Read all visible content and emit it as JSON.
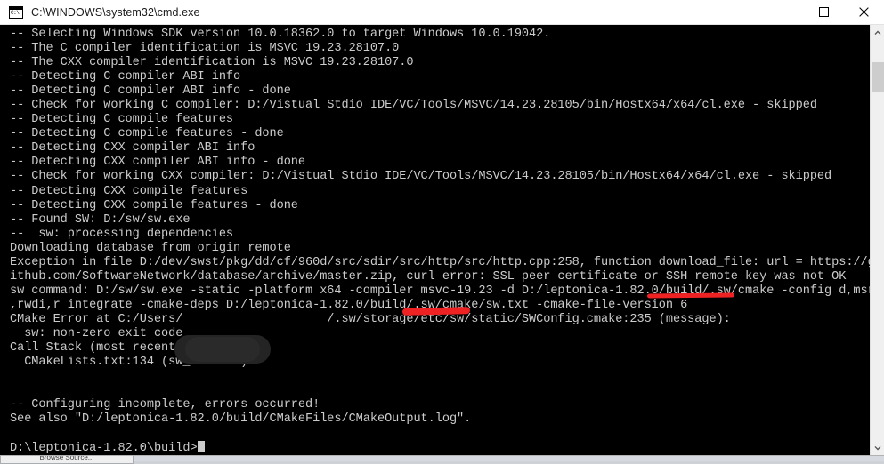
{
  "window": {
    "title": "C:\\WINDOWS\\system32\\cmd.exe",
    "icon": "cmd-console-icon",
    "minimize_label": "Minimize",
    "maximize_label": "Maximize",
    "close_label": "Close",
    "bg_color": "#000000",
    "text_color": "#cccccc",
    "titlebar_color": "#ffffff"
  },
  "console": {
    "lines": [
      "-- Selecting Windows SDK version 10.0.18362.0 to target Windows 10.0.19042.",
      "-- The C compiler identification is MSVC 19.23.28107.0",
      "-- The CXX compiler identification is MSVC 19.23.28107.0",
      "-- Detecting C compiler ABI info",
      "-- Detecting C compiler ABI info - done",
      "-- Check for working C compiler: D:/Vistual Stdio IDE/VC/Tools/MSVC/14.23.28105/bin/Hostx64/x64/cl.exe - skipped",
      "-- Detecting C compile features",
      "-- Detecting C compile features - done",
      "-- Detecting CXX compiler ABI info",
      "-- Detecting CXX compiler ABI info - done",
      "-- Check for working CXX compiler: D:/Vistual Stdio IDE/VC/Tools/MSVC/14.23.28105/bin/Hostx64/x64/cl.exe - skipped",
      "-- Detecting CXX compile features",
      "-- Detecting CXX compile features - done",
      "-- Found SW: D:/sw/sw.exe",
      "--  sw: processing dependencies",
      "Downloading database from origin remote",
      "Exception in file D:/dev/swst/pkg/dd/cf/960d/src/sdir/src/http/src/http.cpp:258, function download_file: url = https://g",
      "ithub.com/SoftwareNetwork/database/archive/master.zip, curl error: SSL peer certificate or SSH remote key was not OK",
      "sw command: D:/sw/sw.exe -static -platform x64 -compiler msvc-19.23 -d D:/leptonica-1.82.0/build/.sw/cmake -config d,msr",
      ",rwdi,r integrate -cmake-deps D:/leptonica-1.82.0/build/.sw/cmake/sw.txt -cmake-file-version 6",
      "CMake Error at C:/Users/                    /.sw/storage/etc/sw/static/SWConfig.cmake:235 (message):",
      "  sw: non-zero exit code",
      "Call Stack (most recent call first):",
      "  CMakeLists.txt:134 (sw_execute)",
      "",
      "",
      "-- Configuring incomplete, errors occurred!",
      "See also \"D:/leptonica-1.82.0/build/CMakeFiles/CMakeOutput.log\".",
      "",
      "D:\\leptonica-1.82.0\\build>"
    ],
    "prompt": "D:\\leptonica-1.82.0\\build>",
    "cursor_visible": true
  },
  "annotations": {
    "red_color": "#ee2222",
    "marks": [
      {
        "name": "underline-download-file",
        "target_text": "download_file",
        "style": "underline"
      },
      {
        "name": "strikeout-msvc-version",
        "target_text": "msvc-19",
        "style": "strikeout"
      }
    ],
    "redactions": [
      {
        "name": "username-redaction",
        "target_text": "C:/Users/<username>",
        "color": "#242424"
      }
    ]
  },
  "scrollbar": {
    "up_arrow": "scroll-up-arrow",
    "down_arrow": "scroll-down-arrow",
    "thumb_position_percent": 6,
    "track_color": "#f0f0f0",
    "thumb_color": "#cdcdcd"
  },
  "background": {
    "other_window_label": "Browse Source..."
  }
}
